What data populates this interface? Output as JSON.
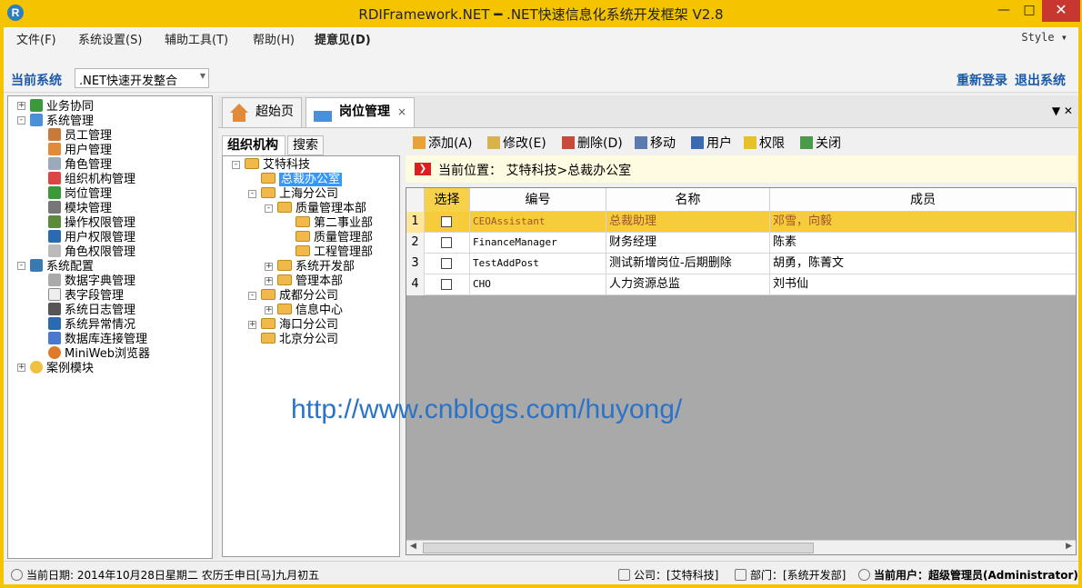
{
  "window": {
    "title": "RDIFramework.NET ━ .NET快速信息化系统开发框架 V2.8",
    "logo_letter": "R",
    "min": "—",
    "max": "□",
    "close": "✕"
  },
  "menu": {
    "items": [
      "文件(F)",
      "系统设置(S)",
      "辅助工具(T)",
      "帮助(H)",
      "提意见(D)"
    ],
    "style": "Style ▾"
  },
  "system": {
    "label": "当前系统",
    "value": ".NET快速开发整合",
    "relogin": "重新登录",
    "exit": "退出系统"
  },
  "nav_tree": [
    {
      "label": "业务协同",
      "exp": "+"
    },
    {
      "label": "系统管理",
      "exp": "-"
    },
    {
      "label": "员工管理"
    },
    {
      "label": "用户管理"
    },
    {
      "label": "角色管理"
    },
    {
      "label": "组织机构管理"
    },
    {
      "label": "岗位管理"
    },
    {
      "label": "模块管理"
    },
    {
      "label": "操作权限管理"
    },
    {
      "label": "用户权限管理"
    },
    {
      "label": "角色权限管理"
    },
    {
      "label": "系统配置",
      "exp": "-"
    },
    {
      "label": "数据字典管理"
    },
    {
      "label": "表字段管理"
    },
    {
      "label": "系统日志管理"
    },
    {
      "label": "系统异常情况"
    },
    {
      "label": "数据库连接管理"
    },
    {
      "label": "MiniWeb浏览器"
    },
    {
      "label": "案例模块",
      "exp": "+"
    }
  ],
  "tabs": {
    "home": "超始页",
    "active": "岗位管理",
    "close": "×",
    "menu": "▼ ✕"
  },
  "org": {
    "tab1": "组织机构",
    "tab2": "搜索",
    "nodes": [
      "艾特科技",
      "总裁办公室",
      "上海分公司",
      "质量管理本部",
      "第二事业部",
      "质量管理部",
      "工程管理部",
      "系统开发部",
      "管理本部",
      "成都分公司",
      "信息中心",
      "海口分公司",
      "北京分公司"
    ]
  },
  "actions": [
    "添加(A)",
    "修改(E)",
    "删除(D)",
    "移动",
    "用户",
    "权限",
    "关闭"
  ],
  "location": {
    "icon": "❯",
    "text": "当前位置： 艾特科技>总裁办公室"
  },
  "grid": {
    "columns": [
      "选择",
      "编号",
      "名称",
      "成员"
    ],
    "rows": [
      {
        "n": "1",
        "code": "CEOAssistant",
        "name": "总裁助理",
        "members": "邓雪，向毅"
      },
      {
        "n": "2",
        "code": "FinanceManager",
        "name": "财务经理",
        "members": "陈素"
      },
      {
        "n": "3",
        "code": "TestAddPost",
        "name": "测试新增岗位-后期删除",
        "members": "胡勇，陈菁文"
      },
      {
        "n": "4",
        "code": "CHO",
        "name": "人力资源总监",
        "members": "刘书仙"
      }
    ]
  },
  "watermark": "http://www.cnblogs.com/huyong/",
  "status": {
    "date": "当前日期: 2014年10月28日星期二 农历壬申日[马]九月初五",
    "company": "公司：[艾特科技]",
    "dept": "部门：[系统开发部]",
    "user": "当前用户：超级管理员(Administrator)"
  },
  "colors": {
    "titlebar": "#f5c400",
    "accent": "#1a5aa8",
    "highlight_row": "#f7cc3c"
  }
}
